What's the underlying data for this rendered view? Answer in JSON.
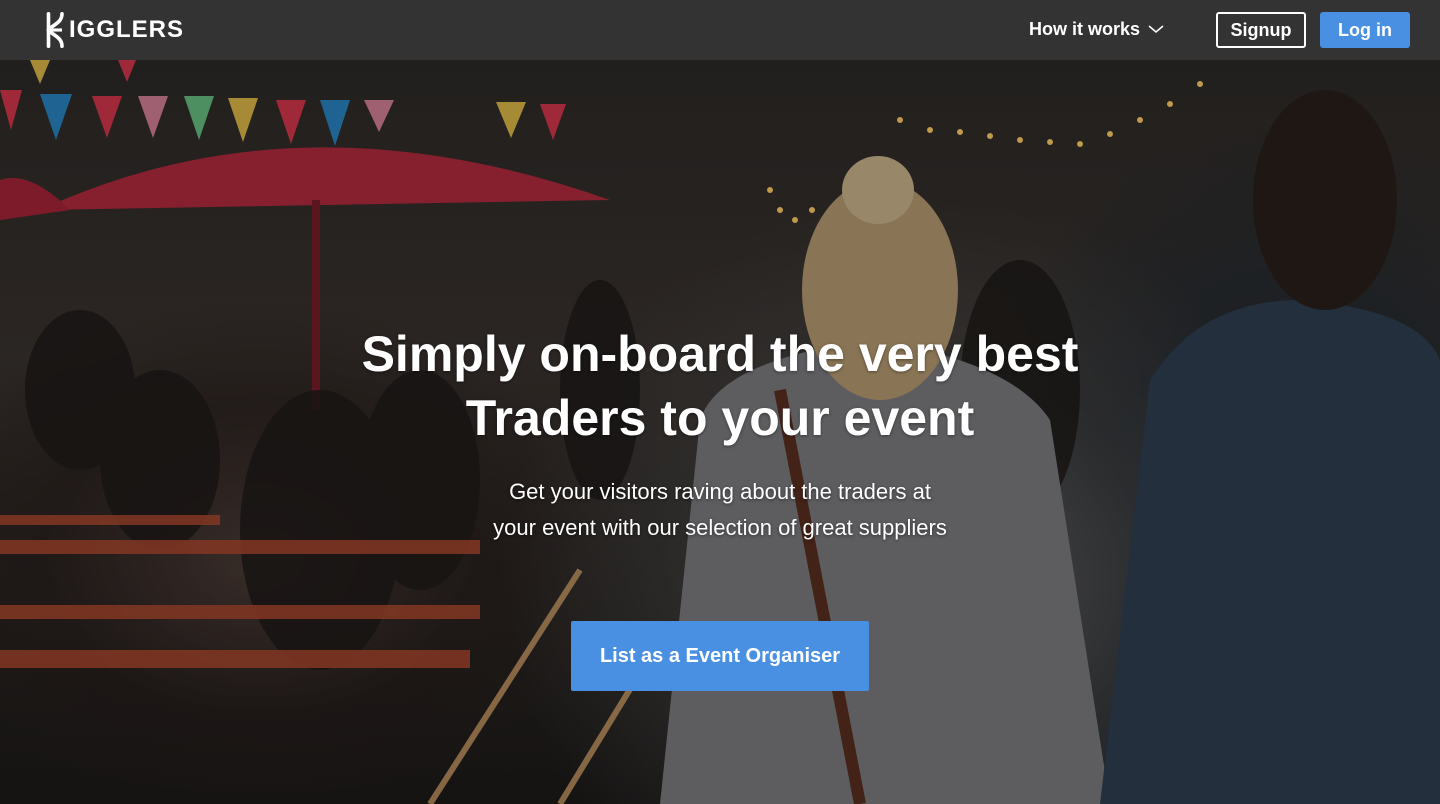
{
  "brand": {
    "logo_text": "IGGLERS",
    "logo_mark": "higglers-h-logo"
  },
  "nav": {
    "how_it_works": "How it works",
    "how_it_works_icon": "chevron-down-icon",
    "signup": "Signup",
    "login": "Log in"
  },
  "hero": {
    "title_line1": "Simply on-board the very best",
    "title_line2": "Traders to your event",
    "subtitle_line1": "Get your visitors raving about the traders at",
    "subtitle_line2": "your event with our selection of great suppliers",
    "cta": "List as a Event Organiser"
  },
  "colors": {
    "navbar": "#333333",
    "accent": "#4a90e2",
    "text": "#ffffff"
  }
}
